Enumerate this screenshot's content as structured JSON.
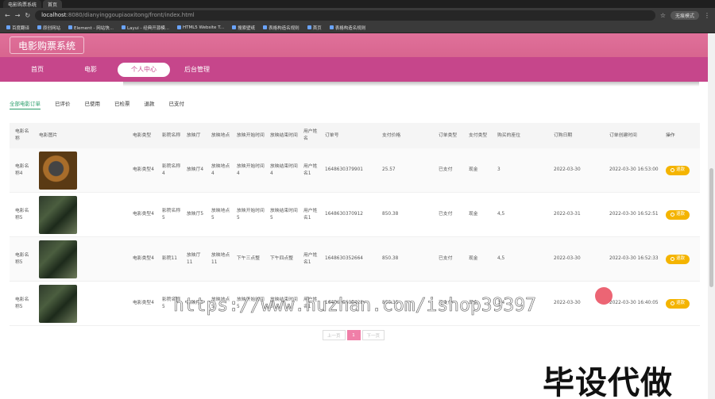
{
  "browser": {
    "tabs": [
      "电影购票系统",
      "首页"
    ],
    "url_host": "localhost",
    "url_rest": ":8080/dianyinggoupiaoxitong/front/index.html",
    "profile": "无痕模式",
    "bookmarks": [
      "百度翻译",
      "原创网站",
      "Element - 网站快...",
      "Layui - 经典开源模...",
      "HTML5 Website T...",
      "搜索壁纸",
      "表格构造名规则",
      "首页",
      "表格构造名规则"
    ]
  },
  "site": {
    "title": "电影购票系统",
    "nav": [
      "首页",
      "电影",
      "个人中心",
      "后台管理"
    ],
    "nav_active": 2
  },
  "order_tabs": [
    "全部电影订单",
    "已评价",
    "已使用",
    "已检票",
    "退款",
    "已支付"
  ],
  "table": {
    "headers": [
      "电影名称",
      "电影图片",
      "电影类型",
      "影院名称",
      "放映厅",
      "放映地点",
      "放映开始时间",
      "放映结束时间",
      "用户姓名",
      "订单号",
      "支付价格",
      "订单类型",
      "支付类型",
      "购买的座位",
      "订购日期",
      "订单创建时间",
      "操作"
    ],
    "rows": [
      {
        "name": "电影名称4",
        "img": "reel",
        "type": "电影类型4",
        "cinema": "影院名称4",
        "hall": "放映厅4",
        "place": "放映地点4",
        "start": "放映开始时间4",
        "end": "放映结束时间4",
        "user": "用户姓名1",
        "order_no": "1648630379901",
        "price": "25.57",
        "order_type": "已支付",
        "pay_type": "现金",
        "seat": "3",
        "date": "2022-03-30",
        "created": "2022-03-30 16:53:00",
        "action": "退款"
      },
      {
        "name": "电影名称5",
        "img": "photo",
        "type": "电影类型4",
        "cinema": "影院名称5",
        "hall": "放映厅5",
        "place": "放映地点5",
        "start": "放映开始时间5",
        "end": "放映结束时间5",
        "user": "用户姓名1",
        "order_no": "1648630370912",
        "price": "850.38",
        "order_type": "已支付",
        "pay_type": "现金",
        "seat": "4,5",
        "date": "2022-03-31",
        "created": "2022-03-30 16:52:51",
        "action": "退款"
      },
      {
        "name": "电影名称5",
        "img": "photo",
        "type": "电影类型4",
        "cinema": "影院11",
        "hall": "放映厅11",
        "place": "放映地点11",
        "start": "下午三点整",
        "end": "下午四点整",
        "user": "用户姓名1",
        "order_no": "1648630352664",
        "price": "850.38",
        "order_type": "已支付",
        "pay_type": "现金",
        "seat": "4,5",
        "date": "2022-03-30",
        "created": "2022-03-30 16:52:33",
        "action": "退款"
      },
      {
        "name": "电影名称5",
        "img": "photo",
        "type": "电影类型4",
        "cinema": "影院名称5",
        "hall": "放映厅5",
        "place": "放映地点5",
        "start": "放映开始时间5",
        "end": "放映结束时间5",
        "user": "用户姓名1",
        "order_no": "1648629605428",
        "price": "850.38",
        "order_type": "已支付",
        "pay_type": "现金",
        "seat": "3,4",
        "date": "2022-03-30",
        "created": "2022-03-30 16:40:05",
        "action": "退款"
      }
    ]
  },
  "pager": {
    "prev": "上一页",
    "current": "1",
    "next": "下一页"
  },
  "overlay": {
    "watermark": "https://www.huzhan.com/ishop39397",
    "big_text": "毕设代做"
  },
  "colors": {
    "header": "#d8658f",
    "nav": "#c6468b",
    "accent_tab": "#2a9d6a",
    "action_button": "#f4b400",
    "pager_active": "#f07fa8"
  }
}
